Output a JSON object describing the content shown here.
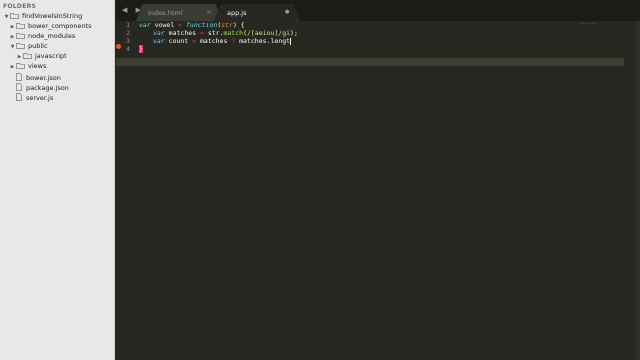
{
  "sidebar": {
    "header": "FOLDERS",
    "root": {
      "name": "findVowelsInString"
    },
    "items": [
      {
        "name": "bower_components"
      },
      {
        "name": "node_modules"
      },
      {
        "name": "public"
      },
      {
        "name": "javascript"
      },
      {
        "name": "views"
      },
      {
        "name": "bower.json"
      },
      {
        "name": "package.json"
      },
      {
        "name": "server.js"
      }
    ]
  },
  "tabs": [
    {
      "label": "index.html",
      "close": "×",
      "active": false
    },
    {
      "label": "app.js",
      "close": "●",
      "active": true
    }
  ],
  "nav": {
    "arrows": "◀ ▶"
  },
  "editor": {
    "line_numbers": [
      "1",
      "2",
      "3",
      "4"
    ],
    "code": {
      "l1_var": "var",
      "l1_name": " vowel ",
      "l1_eq": "=",
      "l1_function": " function",
      "l1_open": "(",
      "l1_param": "str",
      "l1_close": ") {",
      "l2_var": "var",
      "l2_name": " matches ",
      "l2_eq": "=",
      "l2_obj": " str.",
      "l2_method": "match",
      "l2_open": "(",
      "l2_regex": "/[aeiou]/gi",
      "l2_end": ");",
      "l3_var": "var",
      "l3_name": " count ",
      "l3_eq": "=",
      "l3_mid": " matches ",
      "l3_q": "?",
      "l3_tail": " matches.lengt",
      "l4_brace": "}"
    },
    "minimap_text": "~~~~~~~~~~"
  },
  "colors": {
    "editor_bg": "#272822",
    "sidebar_bg": "#e8e8e8",
    "keyword": "#66d9ef",
    "function": "#a6e22e",
    "operator": "#f92672",
    "parameter": "#fd971f",
    "string": "#e6db74"
  }
}
